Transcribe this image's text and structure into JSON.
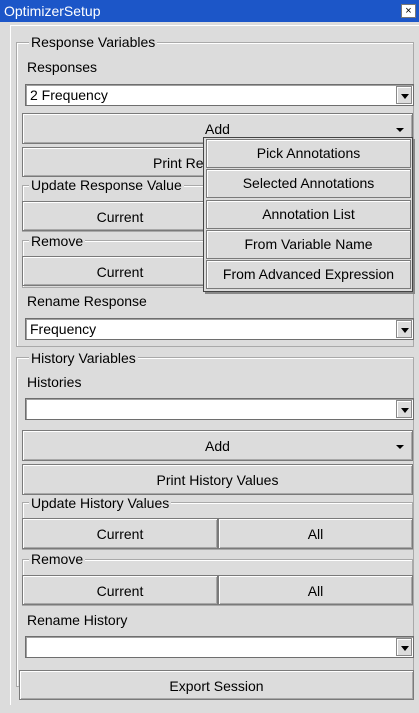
{
  "window": {
    "title": "OptimizerSetup",
    "close_glyph": "×"
  },
  "response_variables": {
    "group_title": "Response Variables",
    "responses_label": "Responses",
    "responses_value": "2 Frequency",
    "add_label": "Add",
    "print_label": "Print Res",
    "update_group_title": "Update Response Value",
    "update_current": "Current",
    "remove_group_title": "Remove",
    "remove_current": "Current",
    "rename_label": "Rename Response",
    "rename_value": "Frequency"
  },
  "add_menu": {
    "items": [
      "Pick Annotations",
      "Selected Annotations",
      "Annotation List",
      "From Variable Name",
      "From Advanced Expression"
    ]
  },
  "history_variables": {
    "group_title": "History Variables",
    "histories_label": "Histories",
    "histories_value": "",
    "add_label": "Add",
    "print_label": "Print History Values",
    "update_group_title": "Update History Values",
    "update_current": "Current",
    "update_all": "All",
    "remove_group_title": "Remove",
    "remove_current": "Current",
    "remove_all": "All",
    "rename_label": "Rename History",
    "rename_value": ""
  },
  "export_label": "Export Session"
}
